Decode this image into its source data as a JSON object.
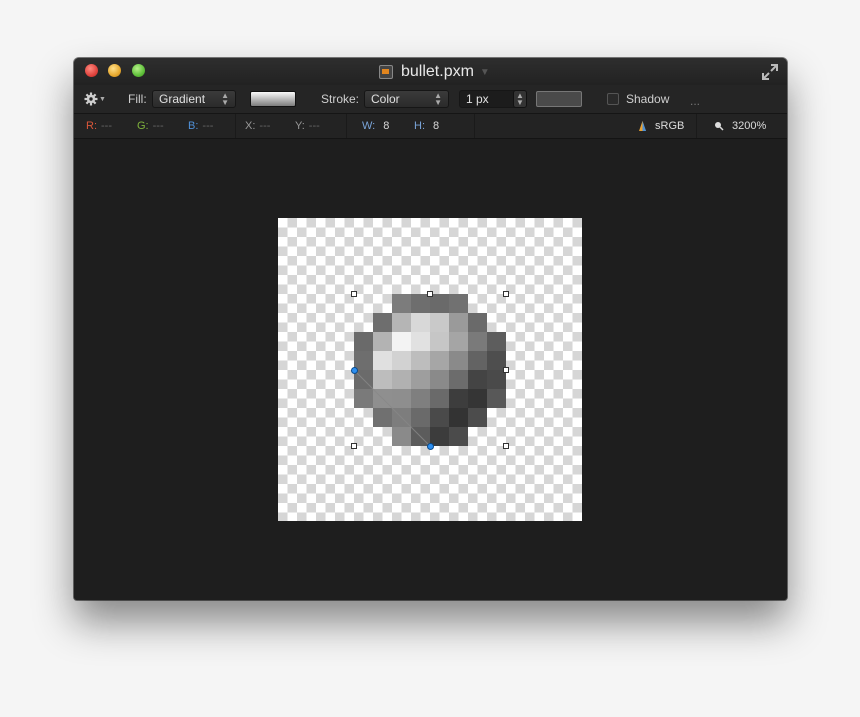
{
  "window": {
    "title": "bullet.pxm"
  },
  "toolbar": {
    "fill_label": "Fill:",
    "fill_value": "Gradient",
    "stroke_label": "Stroke:",
    "stroke_value": "Color",
    "stroke_width": "1 px",
    "shadow_label": "Shadow",
    "more": "..."
  },
  "info": {
    "r_label": "R:",
    "r_value": "---",
    "g_label": "G:",
    "g_value": "---",
    "b_label": "B:",
    "b_value": "---",
    "x_label": "X:",
    "x_value": "---",
    "y_label": "Y:",
    "y_value": "---",
    "w_label": "W:",
    "w_value": "8",
    "h_label": "H:",
    "h_value": "8",
    "color_profile": "sRGB",
    "zoom": "3200%"
  },
  "colors": {
    "r": "#d9573a",
    "g": "#7fb33c",
    "b": "#4f8fd6",
    "accent": "#2d8ff0"
  },
  "icons": [
    "gear-icon",
    "document-icon",
    "fullscreen-icon",
    "zoom-icon",
    "color-profile-icon"
  ],
  "pixel_art": {
    "grid": [
      [
        "",
        "",
        "#7c7c7c",
        "#6e6e6e",
        "#6a6a6a",
        "#717171",
        "",
        ""
      ],
      [
        "",
        "#6e6e6e",
        "#b5b5b5",
        "#d8d8d8",
        "#c9c9c9",
        "#9a9a9a",
        "#6a6a6a",
        ""
      ],
      [
        "#6a6a6a",
        "#b3b3b3",
        "#f3f3f3",
        "#e1e1e1",
        "#c6c6c6",
        "#a5a5a5",
        "#7a7a7a",
        "#5d5d5d"
      ],
      [
        "#6e6e6e",
        "#e0e0e0",
        "#d2d2d2",
        "#bdbdbd",
        "#a6a6a6",
        "#8a8a8a",
        "#636363",
        "#4e4e4e"
      ],
      [
        "#6b6b6b",
        "#bdbdbd",
        "#b1b1b1",
        "#9e9e9e",
        "#8a8a8a",
        "#6c6c6c",
        "#444444",
        "#4a4a4a"
      ],
      [
        "#7a7a7a",
        "#8f8f8f",
        "#8e8e8e",
        "#7f7f7f",
        "#6a6a6a",
        "#3d3d3d",
        "#353535",
        "#585858"
      ],
      [
        "",
        "#707070",
        "#7d7d7d",
        "#6a6a6a",
        "#4a4a4a",
        "#333333",
        "#4c4c4c",
        ""
      ],
      [
        "",
        "",
        "#8a8a8a",
        "#5c5c5c",
        "#3c3c3c",
        "#4b4b4b",
        "",
        ""
      ]
    ]
  }
}
